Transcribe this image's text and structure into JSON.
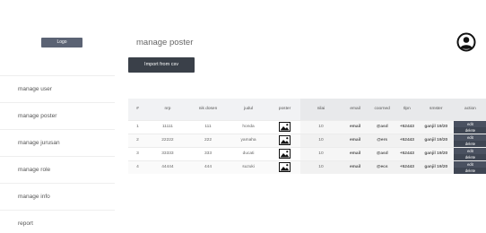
{
  "sidebar": {
    "logo": "Logo",
    "items": [
      {
        "label": "manage user"
      },
      {
        "label": "manage poster"
      },
      {
        "label": "manage jurusan"
      },
      {
        "label": "manage role"
      },
      {
        "label": "manage info"
      },
      {
        "label": "report"
      }
    ]
  },
  "main": {
    "title": "manage poster",
    "import_label": "Import from csv"
  },
  "table": {
    "headers": [
      "#",
      "nrp",
      "nik dosen",
      "judul",
      "poster",
      "nilai",
      "email",
      "coorned",
      "tlpn",
      "smster",
      "action"
    ],
    "rows": [
      {
        "no": "1",
        "nrp": "11111",
        "nik": "111",
        "judul": "honda",
        "nilai": "10",
        "email": "email",
        "coorned": "@asd",
        "tlpn": "+52443",
        "smster": "ganjil 19/20",
        "edit": "edit",
        "delete": "delete"
      },
      {
        "no": "2",
        "nrp": "22222",
        "nik": "222",
        "judul": "yamaha",
        "nilai": "10",
        "email": "email",
        "coorned": "@ers",
        "tlpn": "+52443",
        "smster": "ganjil 19/20",
        "edit": "edit",
        "delete": "delete"
      },
      {
        "no": "3",
        "nrp": "33333",
        "nik": "333",
        "judul": "ducati",
        "nilai": "10",
        "email": "email",
        "coorned": "@asd",
        "tlpn": "+52443",
        "smster": "ganjil 19/20",
        "edit": "edit",
        "delete": "delete"
      },
      {
        "no": "4",
        "nrp": "44444",
        "nik": "444",
        "judul": "suzuki",
        "nilai": "10",
        "email": "email",
        "coorned": "@ecs",
        "tlpn": "+52443",
        "smster": "ganjil 19/20",
        "edit": "edit",
        "delete": "delete"
      }
    ]
  },
  "colors": {
    "button_dark": "#3a4049",
    "logo_bg": "#5b6374",
    "action_bg": "#4a5160"
  },
  "icons": {
    "user": "user-circle-icon",
    "poster": "image-icon"
  }
}
